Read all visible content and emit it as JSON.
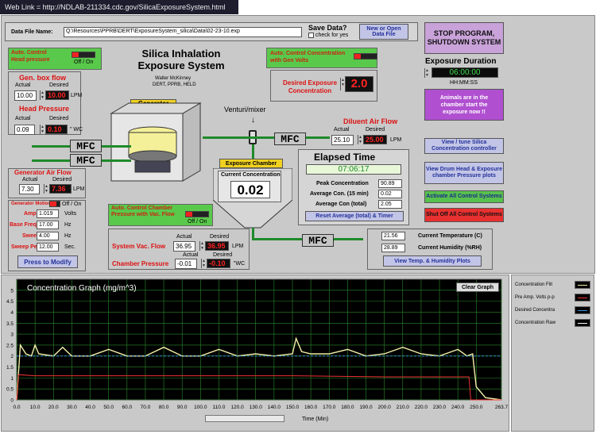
{
  "weblink": "Web Link = http://NDLAB-211334.cdc.gov/SilicaExposureSystem.html",
  "datafile": {
    "label": "Data File Name:",
    "value": "Q:\\Resources\\PPRB\\DERT\\ExposureSystem_silica\\Data\\02-23-10.exp",
    "save_label": "Save Data?",
    "check_label": "check for yes",
    "open_btn": "New or Open Data File"
  },
  "title": {
    "main": "Silica Inhalation Exposure System",
    "author": "Walter McKinney",
    "dept": "DERT, PPRB, HELD"
  },
  "head_ctrl": {
    "label": "Auto. Control Head pressure",
    "toggle": "Off / On"
  },
  "gen_box": {
    "title": "Gen. box flow",
    "actual_label": "Actual",
    "desired_label": "Desired",
    "actual": "10.00",
    "desired": "10.00",
    "unit": "LPM"
  },
  "head_pressure": {
    "title": "Head Pressure",
    "actual_label": "Actual",
    "desired_label": "Desired",
    "actual": "0.09",
    "desired": "0.10",
    "unit": "\" WC"
  },
  "generator": {
    "label": "Generator"
  },
  "conc_ctrl": {
    "label": "Auto. Control Concentration with Gen Volts",
    "desired_label": "Desired Exposure Concentration",
    "desired": "2.0"
  },
  "venturi_label": "Venturi/mixer",
  "diluent": {
    "title": "Diluent Air Flow",
    "actual_label": "Actual",
    "desired_label": "Desired",
    "actual": "25.10",
    "desired": "25.00",
    "unit": "LPM"
  },
  "mfc": "MFC",
  "gen_air": {
    "title": "Generator Air Flow",
    "actual_label": "Actual",
    "desired_label": "Desired",
    "actual": "7.30",
    "desired": "7.36",
    "unit": "LPM"
  },
  "gen_motion": {
    "label": "Generator Motion",
    "toggle": "Off / On"
  },
  "amplitude": {
    "label": "Amplitude",
    "value": "1.019",
    "unit": "Volts"
  },
  "base_freq": {
    "label": "Base Frequency",
    "value": "17.00",
    "unit": "Hz"
  },
  "sweep": {
    "label": "Sweep +/-",
    "value": "4.00",
    "unit": "Hz"
  },
  "sweep_period": {
    "label": "Sweep Period",
    "value": "12.00",
    "unit": "Sec."
  },
  "press_modify": "Press to Modify",
  "exposure_chamber": "Exposure Chamber",
  "current_conc": {
    "label": "Current Concentration",
    "value": "0.02"
  },
  "chamber_ctrl": {
    "label": "Auto. Control Chamber Pressure with Vac. Flow",
    "toggle": "Off / On"
  },
  "vac_flow": {
    "label": "System Vac. Flow",
    "actual_label": "Actual",
    "desired_label": "Desired",
    "actual": "36.95",
    "desired": "36.95",
    "unit": "LPM"
  },
  "chamber_pressure": {
    "label": "Chamber Pressure",
    "actual_label": "Actual",
    "desired_label": "Desired",
    "actual": "-0.01",
    "desired": "-0.10",
    "unit": "\"WC"
  },
  "elapsed": {
    "title": "Elapsed Time",
    "value": "07:06:17",
    "peak_label": "Peak Concentration",
    "peak": "90.89",
    "avg15_label": "Average Con. (15 min)",
    "avg15": "0.02",
    "avgtotal_label": "Average Con (total)",
    "avgtotal": "2.05",
    "reset_btn": "Reset Average (total) & Timer"
  },
  "temp": {
    "value": "21.56",
    "label": "Current Temperature (C)"
  },
  "humidity": {
    "value": "28.89",
    "label": "Current Humidity (%RH)"
  },
  "plots_btn": "View Temp. & Humidity Plots",
  "stop_btn": "STOP PROGRAM, SHUTDOWN SYSTEM",
  "duration": {
    "title": "Exposure Duration",
    "value": "06:00:00",
    "format": "HH:MM:SS"
  },
  "animals_msg": "Animals are in the chamber start the exposure now !!",
  "tune_btn": "View / tune Silica Concentration controller",
  "drum_btn": "View Drum Head & Exposure chamber Pressure plots",
  "activate_btn": "Activate All Control Systems",
  "shutoff_btn": "Shut Off All Control Systems",
  "graph": {
    "title": "Concentration Graph (mg/m^3)",
    "clear_btn": "Clear Graph",
    "xlabel": "Time (Min)"
  },
  "legend": [
    "Concentration Filt",
    "Pre Amp. Volts p-p",
    "Desired Concentra",
    "Concentration Raw"
  ],
  "colors": {
    "filt": "#f4f0a8",
    "preamp": "#e33",
    "desired": "#3a8fd4",
    "raw": "#ffffff"
  },
  "chart_data": {
    "type": "line",
    "title": "Concentration Graph (mg/m^3)",
    "xlabel": "Time (Min)",
    "xlim": [
      0,
      263.7
    ],
    "ylim": [
      0,
      5.5
    ],
    "xticks": [
      "0.0",
      "10.0",
      "20.0",
      "30.0",
      "40.0",
      "50.0",
      "60.0",
      "70.0",
      "80.0",
      "90.0",
      "100.0",
      "110.0",
      "120.0",
      "130.0",
      "140.0",
      "150.0",
      "160.0",
      "170.0",
      "180.0",
      "190.0",
      "200.0",
      "210.0",
      "220.0",
      "230.0",
      "240.0",
      "250.0",
      "263.7"
    ],
    "yticks": [
      "0",
      "0.5",
      "1",
      "1.5",
      "2",
      "2.5",
      "3",
      "3.5",
      "4",
      "4.5",
      "5"
    ],
    "series": [
      {
        "name": "Concentration Filt",
        "x": [
          0,
          2,
          5,
          8,
          10,
          12,
          20,
          25,
          30,
          40,
          50,
          60,
          70,
          80,
          90,
          100,
          110,
          120,
          130,
          140,
          150,
          152,
          155,
          160,
          170,
          180,
          190,
          200,
          210,
          220,
          230,
          240,
          245,
          248,
          250,
          255,
          263.7
        ],
        "y": [
          0,
          2.5,
          2.1,
          2.0,
          2.5,
          2.1,
          2.0,
          2.4,
          2.0,
          2.0,
          2.3,
          2.0,
          2.0,
          2.4,
          2.0,
          2.0,
          2.3,
          2.0,
          2.1,
          2.0,
          2.1,
          2.8,
          2.2,
          2.1,
          2.1,
          2.3,
          2.0,
          2.1,
          2.4,
          2.1,
          2.0,
          2.3,
          2.0,
          2.1,
          0.6,
          0.1,
          0
        ]
      },
      {
        "name": "Pre Amp. Volts p-p",
        "x": [
          0,
          1,
          10,
          50,
          100,
          150,
          200,
          246,
          247,
          263.7
        ],
        "y": [
          0,
          1.15,
          1.1,
          1.1,
          1.1,
          1.1,
          1.05,
          1.05,
          0,
          0
        ]
      },
      {
        "name": "Desired Concentra",
        "x": [
          0,
          263.7
        ],
        "y": [
          2,
          2
        ]
      }
    ]
  }
}
